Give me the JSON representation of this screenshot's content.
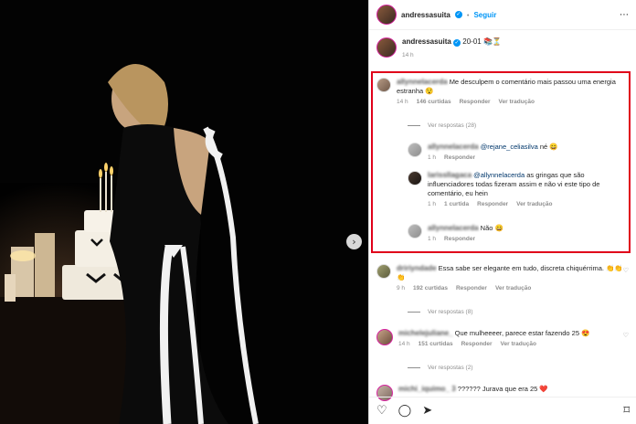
{
  "post": {
    "username": "andressasuita",
    "follow_label": "Seguir",
    "caption": "20-01 📚⏳",
    "caption_time": "14 h",
    "next_icon": "›"
  },
  "comments": [
    {
      "user": "allynnelacerda",
      "text": "Me desculpem o comentário mais passou uma energia estranha 😯",
      "time": "14 h",
      "likes": "146 curtidas",
      "reply": "Responder",
      "translate": "Ver tradução",
      "view_replies": "Ver respostas (28)",
      "replies": [
        {
          "user": "allynnelacerda",
          "mention": "@rejane_celiasilva",
          "text": " né 😄",
          "time": "1 h",
          "reply": "Responder"
        },
        {
          "user": "larissllagaca",
          "mention": "@allynnelacerda",
          "text": " as gringas que são influenciadores todas fizeram assim e não vi este tipo de comentário, eu hein",
          "time": "1 h",
          "likes": "1 curtida",
          "reply": "Responder",
          "translate": "Ver tradução"
        },
        {
          "user": "allynnelacerda",
          "mention": "",
          "text": " Não 😄",
          "time": "1 h",
          "reply": "Responder"
        }
      ]
    },
    {
      "user": "dririyndade",
      "text": " Essa sabe ser elegante em tudo, discreta chiquérrima. 👏👏👏",
      "time": "9 h",
      "likes": "192 curtidas",
      "reply": "Responder",
      "translate": "Ver tradução",
      "view_replies": "Ver respostas (8)"
    },
    {
      "user": "michelejuliane_",
      "text": " Que mulheeeer, parece estar fazendo 25 😍",
      "time": "14 h",
      "likes": "151 curtidas",
      "reply": "Responder",
      "translate": "Ver tradução",
      "view_replies": "Ver respostas (2)"
    },
    {
      "user": "michi_iquimo_ 3",
      "text": "?????? Jurava que era 25 ❤️"
    }
  ],
  "actions": {
    "like_icon": "♡",
    "comment_icon": "◯",
    "share_icon": "➤",
    "save_icon": "⌑"
  },
  "colors": {
    "accent": "#0095f6",
    "highlight": "#e0001a"
  }
}
